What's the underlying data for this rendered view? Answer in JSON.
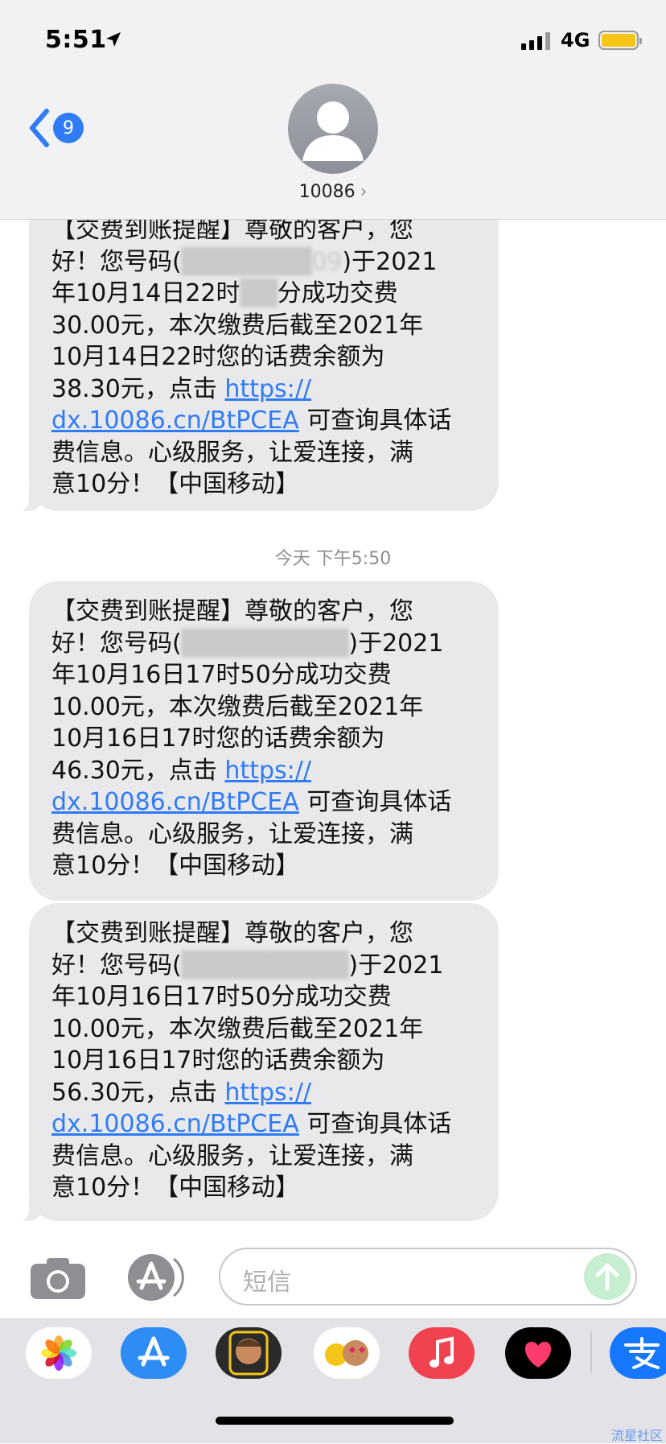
{
  "status_bar": {
    "time": "5:51",
    "network": "4G"
  },
  "nav": {
    "back_count": "9",
    "contact": "10086",
    "chevron": "›"
  },
  "messages": [
    {
      "lines": [
        "【交费到账提醒】尊敬的客户，您",
        "好！您号码(",
        "09",
        ")于2021",
        "年10月14日22时",
        "分成功交费",
        "30.00元，本次缴费后截至2021年",
        "10月14日22时您的话费余额为",
        "38.30元，点击 ",
        "https://",
        "dx.10086.cn/BtPCEA",
        " 可查询具体话",
        "费信息。心级服务，让爱连接，满",
        "意10分！【中国移动】"
      ]
    },
    {
      "lines": [
        "【交费到账提醒】尊敬的客户，您",
        "好！您号码(",
        ")于2021",
        "年10月16日",
        "17时50分成功交费",
        "10.00元，本次缴费后截至2021年",
        "10月16日17时您的话费余额为",
        "46.30元，点击 ",
        "https://",
        "dx.10086.cn/BtPCEA",
        " 可查询具体话",
        "费信息。心级服务，让爱连接，满",
        "意10分！【中国移动】"
      ]
    },
    {
      "lines": [
        "【交费到账提醒】尊敬的客户，您",
        "好！您号码(",
        ")于2021",
        "年10月16日",
        "17时50分成功交费",
        "10.00元，本次缴费后截至2021年",
        "10月16日17时您的话费余额为",
        "56.30元，点击 ",
        "https://",
        "dx.10086.cn/BtPCEA",
        " 可查询具体话",
        "费信息。心级服务，让爱连接，满",
        "意10分！【中国移动】"
      ]
    }
  ],
  "timestamp": "今天 下午5:50",
  "input": {
    "placeholder": "短信"
  },
  "tray_icons": [
    "photos-icon",
    "app-store-icon",
    "memoji-icon",
    "animoji-icon",
    "music-icon",
    "heart-app-icon",
    "alipay-icon"
  ],
  "watermark": "流星社区"
}
